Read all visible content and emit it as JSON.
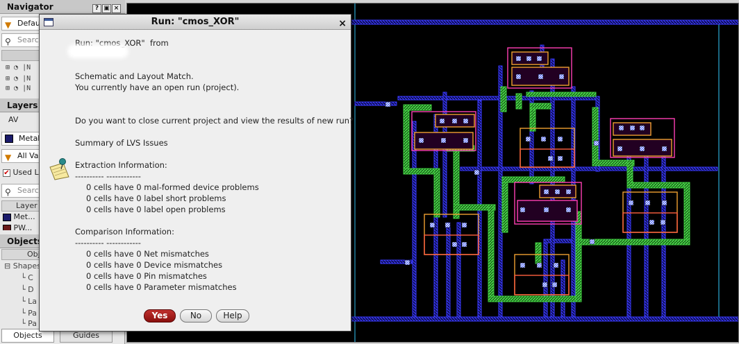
{
  "navigator": {
    "title": "Navigator",
    "filter_value": "Default",
    "search_placeholder": "Search",
    "tree_rows": [
      "|N",
      "|N",
      "|N"
    ]
  },
  "layers": {
    "title": "Layers",
    "mode": "AV",
    "current_layer": "Metal",
    "filter_value": "All Va",
    "used_label": "Used L",
    "search_placeholder": "Search",
    "col_header": "Layer",
    "rows": [
      "Met...",
      "PW..."
    ]
  },
  "objects": {
    "title": "Objects",
    "col_header": "Obj",
    "tree_root": "Shapes",
    "tree_children": [
      "C",
      "D",
      "La",
      "Pa",
      "Pa"
    ],
    "tabs": [
      "Objects",
      "Guides"
    ]
  },
  "dialog": {
    "title": "Run: \"cmos_XOR\"",
    "close_glyph": "×",
    "line_run": "Run: \"cmos_XOR\"  from",
    "line_match": "Schematic and Layout Match.",
    "line_open": "You currently have an open run (project).",
    "line_question": "Do you want to close current project and view the results of new run?",
    "summary": "Summary of LVS Issues",
    "extraction": {
      "heading": "Extraction Information:",
      "rule": "---------- ------------",
      "items": [
        "0 cells have 0 mal-formed device problems",
        "0 cells have 0 label short problems",
        "0 cells have 0 label open problems"
      ]
    },
    "comparison": {
      "heading": "Comparison Information:",
      "rule": "---------- ------------",
      "items": [
        "0 cells have 0 Net mismatches",
        "0 cells have 0 Device mismatches",
        "0 cells have 0 Pin mismatches",
        "0 cells have 0 Parameter mismatches"
      ]
    },
    "buttons": {
      "yes": "Yes",
      "no": "No",
      "help": "Help"
    },
    "icon": "note-pin-icon"
  },
  "colors": {
    "metal1": "#3a3aff",
    "poly": "#3ec83e",
    "nwell": "#ff3fb4",
    "active": "#f0a030",
    "boundary": "#33ccff",
    "primary_button": "#a01816"
  }
}
